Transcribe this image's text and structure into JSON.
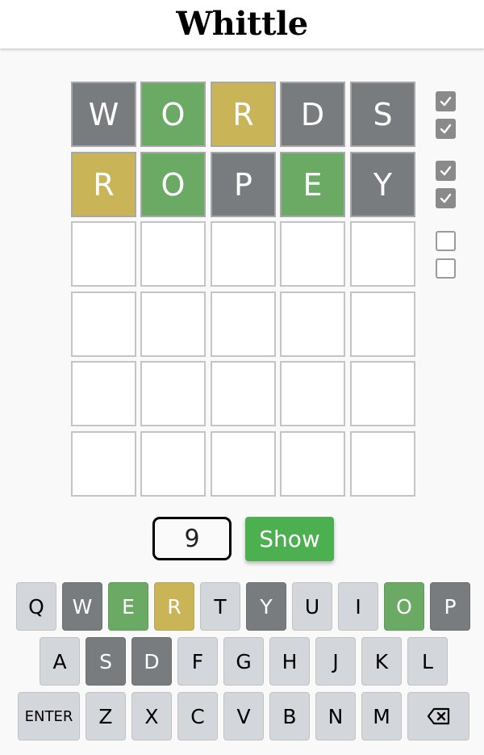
{
  "header": {
    "title": "Whittle"
  },
  "colors": {
    "correct": "#6aaa64",
    "present": "#c9b458",
    "absent": "#787c7e",
    "key_default": "#d3d6da",
    "show_button": "#4caf50"
  },
  "board": {
    "rows": [
      [
        {
          "letter": "W",
          "state": "gray"
        },
        {
          "letter": "O",
          "state": "green"
        },
        {
          "letter": "R",
          "state": "yellow"
        },
        {
          "letter": "D",
          "state": "gray"
        },
        {
          "letter": "S",
          "state": "gray"
        }
      ],
      [
        {
          "letter": "R",
          "state": "yellow"
        },
        {
          "letter": "O",
          "state": "green"
        },
        {
          "letter": "P",
          "state": "gray"
        },
        {
          "letter": "E",
          "state": "green"
        },
        {
          "letter": "Y",
          "state": "gray"
        }
      ],
      [
        {
          "letter": "",
          "state": "empty"
        },
        {
          "letter": "",
          "state": "empty"
        },
        {
          "letter": "",
          "state": "empty"
        },
        {
          "letter": "",
          "state": "empty"
        },
        {
          "letter": "",
          "state": "empty"
        }
      ],
      [
        {
          "letter": "",
          "state": "empty"
        },
        {
          "letter": "",
          "state": "empty"
        },
        {
          "letter": "",
          "state": "empty"
        },
        {
          "letter": "",
          "state": "empty"
        },
        {
          "letter": "",
          "state": "empty"
        }
      ],
      [
        {
          "letter": "",
          "state": "empty"
        },
        {
          "letter": "",
          "state": "empty"
        },
        {
          "letter": "",
          "state": "empty"
        },
        {
          "letter": "",
          "state": "empty"
        },
        {
          "letter": "",
          "state": "empty"
        }
      ],
      [
        {
          "letter": "",
          "state": "empty"
        },
        {
          "letter": "",
          "state": "empty"
        },
        {
          "letter": "",
          "state": "empty"
        },
        {
          "letter": "",
          "state": "empty"
        },
        {
          "letter": "",
          "state": "empty"
        }
      ]
    ]
  },
  "checkboxes": [
    {
      "checked": true
    },
    {
      "checked": true
    },
    {
      "checked": true
    },
    {
      "checked": true
    },
    {
      "checked": false
    },
    {
      "checked": false
    }
  ],
  "controls": {
    "number_value": "9",
    "show_label": "Show"
  },
  "keyboard": {
    "rows": [
      [
        {
          "label": "Q",
          "state": "default"
        },
        {
          "label": "W",
          "state": "gray"
        },
        {
          "label": "E",
          "state": "green"
        },
        {
          "label": "R",
          "state": "yellow"
        },
        {
          "label": "T",
          "state": "default"
        },
        {
          "label": "Y",
          "state": "gray"
        },
        {
          "label": "U",
          "state": "default"
        },
        {
          "label": "I",
          "state": "default"
        },
        {
          "label": "O",
          "state": "green"
        },
        {
          "label": "P",
          "state": "gray"
        }
      ],
      [
        {
          "label": "A",
          "state": "default"
        },
        {
          "label": "S",
          "state": "gray"
        },
        {
          "label": "D",
          "state": "gray"
        },
        {
          "label": "F",
          "state": "default"
        },
        {
          "label": "G",
          "state": "default"
        },
        {
          "label": "H",
          "state": "default"
        },
        {
          "label": "J",
          "state": "default"
        },
        {
          "label": "K",
          "state": "default"
        },
        {
          "label": "L",
          "state": "default"
        }
      ],
      [
        {
          "label": "ENTER",
          "state": "default",
          "wide": true
        },
        {
          "label": "Z",
          "state": "default"
        },
        {
          "label": "X",
          "state": "default"
        },
        {
          "label": "C",
          "state": "default"
        },
        {
          "label": "V",
          "state": "default"
        },
        {
          "label": "B",
          "state": "default"
        },
        {
          "label": "N",
          "state": "default"
        },
        {
          "label": "M",
          "state": "default"
        },
        {
          "label": "",
          "icon": "backspace-icon",
          "state": "default",
          "wide": true
        }
      ]
    ]
  }
}
